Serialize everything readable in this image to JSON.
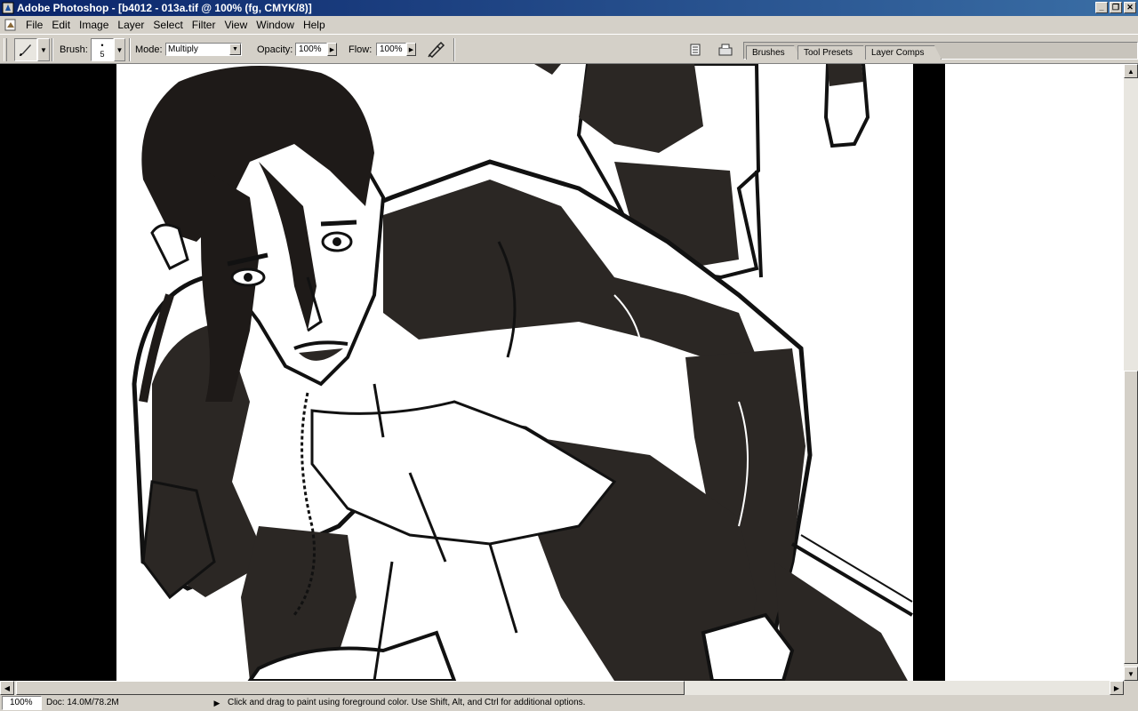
{
  "window": {
    "title": "Adobe Photoshop - [b4012 - 013a.tif @ 100% (fg, CMYK/8)]"
  },
  "menu": [
    "File",
    "Edit",
    "Image",
    "Layer",
    "Select",
    "Filter",
    "View",
    "Window",
    "Help"
  ],
  "options": {
    "brush_label": "Brush:",
    "brush_size": "5",
    "mode_label": "Mode:",
    "mode_value": "Multiply",
    "opacity_label": "Opacity:",
    "opacity_value": "100%",
    "flow_label": "Flow:",
    "flow_value": "100%"
  },
  "palette_tabs": [
    "Brushes",
    "Tool Presets",
    "Layer Comps"
  ],
  "status": {
    "zoom": "100%",
    "doc": "Doc: 14.0M/78.2M",
    "hint": "Click and drag to paint using foreground color.  Use Shift, Alt, and Ctrl for additional options."
  },
  "icons": {
    "app": "photoshop-icon",
    "brush_tool": "brush-icon",
    "airbrush": "airbrush-icon",
    "file_browser": "file-browser-icon",
    "palette_toggle": "palette-icon"
  }
}
